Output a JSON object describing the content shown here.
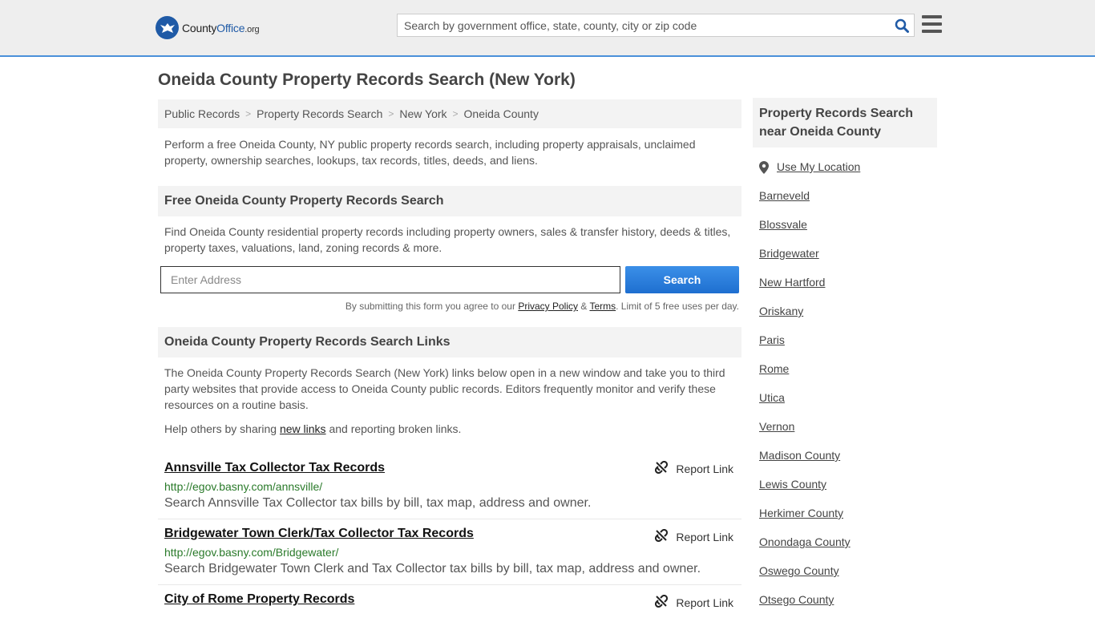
{
  "header": {
    "logo_text_a": "County",
    "logo_text_b": "Office",
    "logo_text_c": ".org",
    "search_placeholder": "Search by government office, state, county, city or zip code"
  },
  "page_title": "Oneida County Property Records Search (New York)",
  "breadcrumb": [
    "Public Records",
    "Property Records Search",
    "New York",
    "Oneida County"
  ],
  "intro": "Perform a free Oneida County, NY public property records search, including property appraisals, unclaimed property, ownership searches, lookups, tax records, titles, deeds, and liens.",
  "free_search": {
    "heading": "Free Oneida County Property Records Search",
    "text": "Find Oneida County residential property records including property owners, sales & transfer history, deeds & titles, property taxes, valuations, land, zoning records & more.",
    "address_placeholder": "Enter Address",
    "button": "Search",
    "fine_a": "By submitting this form you agree to our ",
    "privacy": "Privacy Policy",
    "amp": " & ",
    "terms": "Terms",
    "fine_b": ". Limit of 5 free uses per day."
  },
  "links_section": {
    "heading": "Oneida County Property Records Search Links",
    "text": "The Oneida County Property Records Search (New York) links below open in a new window and take you to third party websites that provide access to Oneida County public records. Editors frequently monitor and verify these resources on a routine basis.",
    "help_a": "Help others by sharing ",
    "help_link": "new links",
    "help_b": " and reporting broken links.",
    "report_label": "Report Link",
    "items": [
      {
        "title": "Annsville Tax Collector Tax Records",
        "url": "http://egov.basny.com/annsville/",
        "desc": "Search Annsville Tax Collector tax bills by bill, tax map, address and owner."
      },
      {
        "title": "Bridgewater Town Clerk/Tax Collector Tax Records",
        "url": "http://egov.basny.com/Bridgewater/",
        "desc": "Search Bridgewater Town Clerk and Tax Collector tax bills by bill, tax map, address and owner."
      },
      {
        "title": "City of Rome Property Records",
        "url": "",
        "desc": ""
      }
    ]
  },
  "sidebar": {
    "heading": "Property Records Search near Oneida County",
    "use_location": "Use My Location",
    "items": [
      "Barneveld",
      "Blossvale",
      "Bridgewater",
      "New Hartford",
      "Oriskany",
      "Paris",
      "Rome",
      "Utica",
      "Vernon",
      "Madison County",
      "Lewis County",
      "Herkimer County",
      "Onondaga County",
      "Oswego County",
      "Otsego County"
    ]
  },
  "colors": {
    "accent": "#1e6fd0",
    "url_green": "#2a7a2a",
    "panel": "#f3f3f3"
  }
}
